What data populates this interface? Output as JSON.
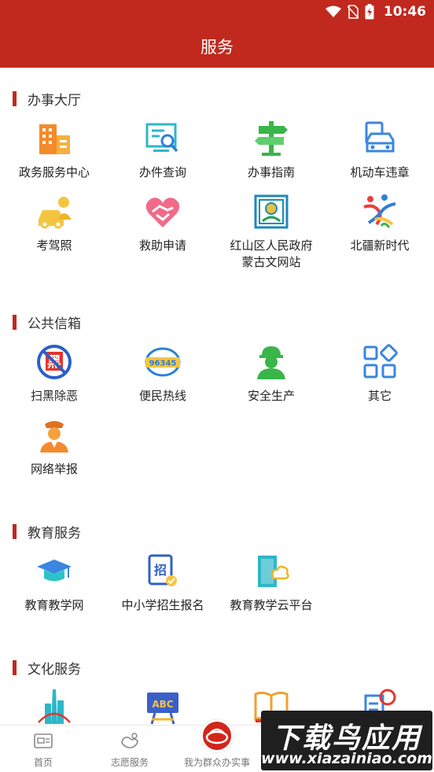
{
  "status": {
    "time": "10:46"
  },
  "page": {
    "title": "服务"
  },
  "sections": [
    {
      "title": "办事大厅",
      "items": [
        {
          "label": "政务服务中心",
          "icon": "government-building-icon"
        },
        {
          "label": "办件查询",
          "icon": "document-search-icon"
        },
        {
          "label": "办事指南",
          "icon": "signpost-icon"
        },
        {
          "label": "机动车违章",
          "icon": "car-violation-icon"
        },
        {
          "label": "考驾照",
          "icon": "driving-license-icon"
        },
        {
          "label": "救助申请",
          "icon": "heart-handshake-icon"
        },
        {
          "label": "红山区人民政府\n蒙古文网站",
          "icon": "mongolian-emblem-icon"
        },
        {
          "label": "北疆新时代",
          "icon": "ribbon-figures-icon"
        }
      ]
    },
    {
      "title": "公共信箱",
      "items": [
        {
          "label": "扫黑除恶",
          "icon": "anti-crime-icon"
        },
        {
          "label": "便民热线",
          "icon": "hotline-96345-icon"
        },
        {
          "label": "安全生产",
          "icon": "safety-worker-icon"
        },
        {
          "label": "其它",
          "icon": "grid-other-icon"
        },
        {
          "label": "网络举报",
          "icon": "police-officer-icon"
        }
      ]
    },
    {
      "title": "教育服务",
      "items": [
        {
          "label": "教育教学网",
          "icon": "graduation-cap-icon"
        },
        {
          "label": "中小学招生报名",
          "icon": "enrollment-badge-icon"
        },
        {
          "label": "教育教学云平台",
          "icon": "cloud-book-icon"
        }
      ]
    },
    {
      "title": "文化服务",
      "items": [
        {
          "icon": "city-tower-icon"
        },
        {
          "icon": "abc-board-icon",
          "text": "ABC"
        },
        {
          "icon": "open-book-icon"
        },
        {
          "icon": "globe-document-icon"
        }
      ]
    }
  ],
  "tabs": [
    {
      "label": "首页",
      "icon": "home-card-icon"
    },
    {
      "label": "志愿服务",
      "icon": "volunteer-hands-icon"
    },
    {
      "label": "我为群众办实事",
      "icon": "emblem-icon"
    },
    {
      "label": "",
      "icon": "hidden-tab-icon"
    },
    {
      "label": "",
      "icon": "hidden-tab-icon"
    }
  ],
  "watermark": {
    "main": "下载鸟应用",
    "sub": "www.xiazainiao.com"
  },
  "colors": {
    "brand_red": "#c1291e",
    "orange": "#f58a2c",
    "blue": "#3a86e0",
    "green": "#39b54a"
  }
}
